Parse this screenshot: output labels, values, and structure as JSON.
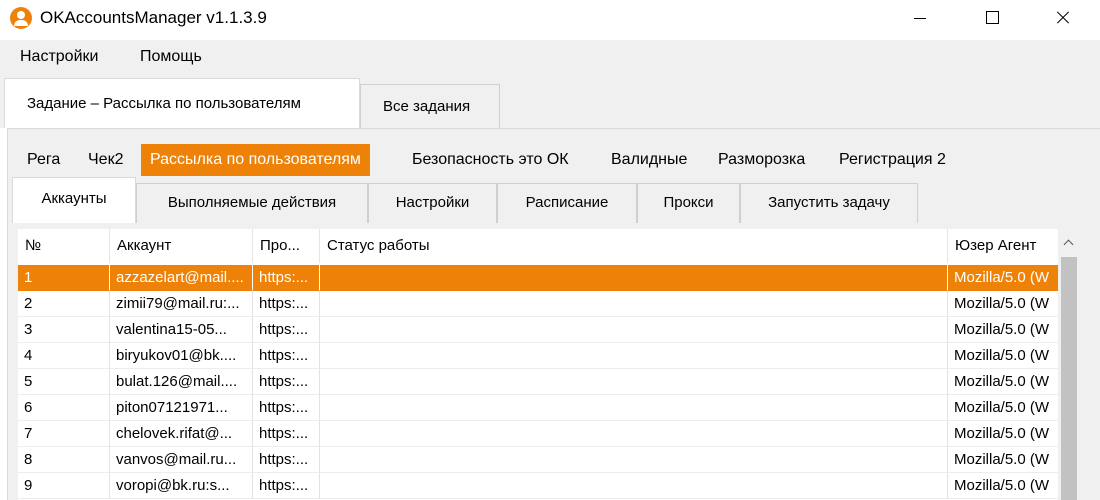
{
  "window": {
    "title": "OKAccountsManager v1.1.3.9"
  },
  "menu": [
    "Настройки",
    "Помощь"
  ],
  "outer_tabs": {
    "active": "Задание – Рассылка по пользователям",
    "inactive": "Все задания"
  },
  "subnav": [
    "Рега",
    "Чек2",
    "Рассылка по пользователям",
    "Безопасность это ОК",
    "Валидные",
    "Разморозка",
    "Регистрация 2"
  ],
  "subnav_active_index": 2,
  "inner_tabs": [
    "Аккаунты",
    "Выполняемые действия",
    "Настройки",
    "Расписание",
    "Прокси",
    "Запустить задачу"
  ],
  "table": {
    "columns": [
      "№",
      "Аккаунт",
      "Про...",
      "Статус работы",
      "Юзер Агент"
    ],
    "rows": [
      [
        "1",
        "azzazelart@mail....",
        "https:...",
        "",
        "Mozilla/5.0 (W"
      ],
      [
        "2",
        "zimii79@mail.ru:...",
        "https:...",
        "",
        "Mozilla/5.0 (W"
      ],
      [
        "3",
        "valentina15-05...",
        "https:...",
        "",
        "Mozilla/5.0 (W"
      ],
      [
        "4",
        "biryukov01@bk....",
        "https:...",
        "",
        "Mozilla/5.0 (W"
      ],
      [
        "5",
        "bulat.126@mail....",
        "https:...",
        "",
        "Mozilla/5.0 (W"
      ],
      [
        "6",
        "piton07121971...",
        "https:...",
        "",
        "Mozilla/5.0 (W"
      ],
      [
        "7",
        "chelovek.rifat@...",
        "https:...",
        "",
        "Mozilla/5.0 (W"
      ],
      [
        "8",
        "vanvos@mail.ru...",
        "https:...",
        "",
        "Mozilla/5.0 (W"
      ],
      [
        "9",
        "voropi@bk.ru:s...",
        "https:...",
        "",
        "Mozilla/5.0 (W"
      ]
    ],
    "selected_row_index": 0
  },
  "colors": {
    "accent": "#ee8208",
    "chrome": "#f0f0f0"
  },
  "icons": {
    "app": "user-circle-icon",
    "minimize": "minimize-icon",
    "maximize": "maximize-icon",
    "close": "close-icon",
    "scroll_up": "chevron-up-icon"
  }
}
